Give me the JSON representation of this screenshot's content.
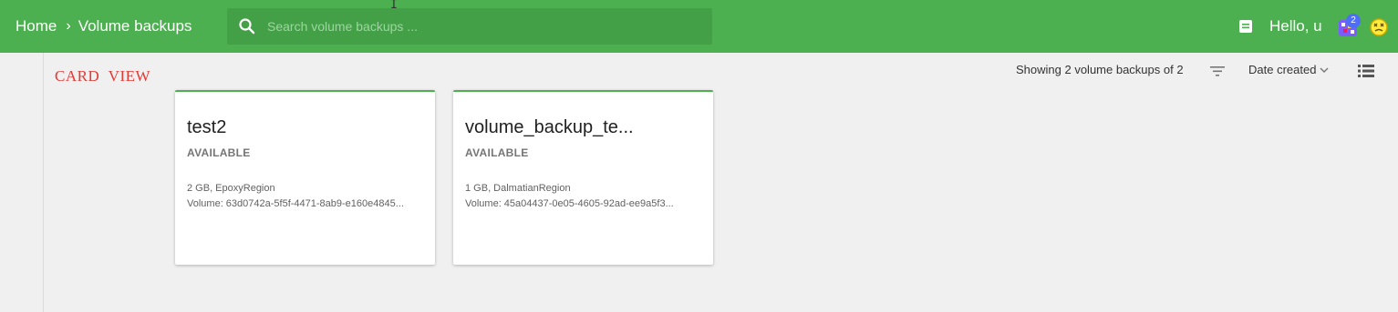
{
  "header": {
    "breadcrumb_home": "Home",
    "breadcrumb_separator": "›",
    "breadcrumb_current": "Volume backups",
    "search_placeholder": "Search volume backups ...",
    "search_value": "",
    "greeting": "Hello, u",
    "notification_count": "2",
    "icons": [
      "search-icon",
      "notes-icon",
      "avatar",
      "face-icon"
    ]
  },
  "annotation": "CARD  VIEW",
  "toolbar": {
    "showing_text": "Showing 2 volume backups of 2",
    "sort_label": "Date created",
    "icons": [
      "filter-icon",
      "chevron-down-icon",
      "list-view-icon"
    ]
  },
  "cards": [
    {
      "title": "test2",
      "status": "AVAILABLE",
      "size_region": "2 GB, EpoxyRegion",
      "volume": "Volume: 63d0742a-5f5f-4471-8ab9-e160e4845..."
    },
    {
      "title": "volume_backup_te...",
      "status": "AVAILABLE",
      "size_region": "1 GB, DalmatianRegion",
      "volume": "Volume: 45a04437-0e05-4605-92ad-ee9a5f3..."
    }
  ],
  "colors": {
    "header_bg": "#4caf50",
    "search_bg": "#43a047",
    "annotation": "#e53935",
    "card_accent": "#4caf50",
    "badge": "#4f6ef7"
  }
}
